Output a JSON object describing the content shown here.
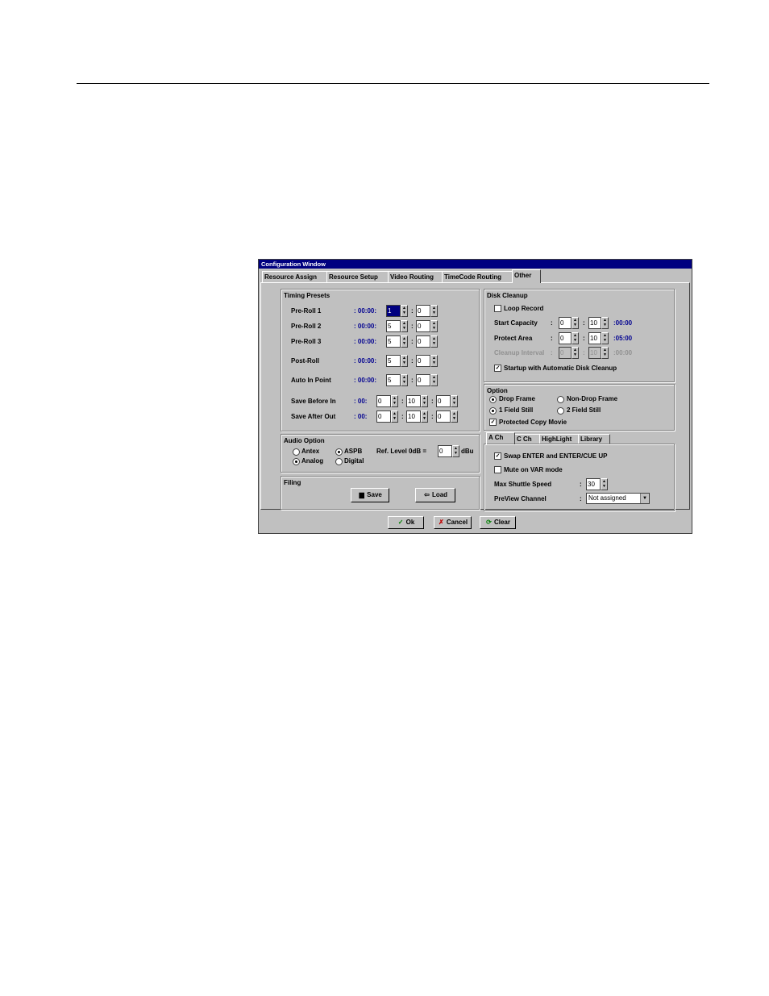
{
  "window": {
    "title": "Configuration Window"
  },
  "tabs": [
    "Resource Assign",
    "Resource Setup",
    "Video Routing",
    "TimeCode Routing",
    "Other"
  ],
  "timing_presets": {
    "title": "Timing Presets",
    "prefix": ": 00:00:",
    "short_prefix": ": 00:",
    "rows": [
      {
        "label": "Pre-Roll 1",
        "sec": "1",
        "frm": "0"
      },
      {
        "label": "Pre-Roll 2",
        "sec": "5",
        "frm": "0"
      },
      {
        "label": "Pre-Roll 3",
        "sec": "5",
        "frm": "0"
      },
      {
        "label": "Post-Roll",
        "sec": "5",
        "frm": "0"
      },
      {
        "label": "Auto In Point",
        "sec": "5",
        "frm": "0"
      }
    ],
    "save_rows": [
      {
        "label": "Save Before In",
        "min": "0",
        "sec": "10",
        "frm": "0"
      },
      {
        "label": "Save After Out",
        "min": "0",
        "sec": "10",
        "frm": "0"
      }
    ]
  },
  "audio_option": {
    "title": "Audio Option",
    "radio1": [
      "Antex",
      "Analog"
    ],
    "radio2": [
      "ASPB",
      "Digital"
    ],
    "ref_label": "Ref. Level 0dB =",
    "ref_value": "0",
    "ref_unit": "dBu"
  },
  "filing": {
    "title": "Filing",
    "save": "Save",
    "load": "Load"
  },
  "disk_cleanup": {
    "title": "Disk Cleanup",
    "loop_record": "Loop Record",
    "start_capacity": {
      "label": "Start Capacity",
      "a": "0",
      "b": "10",
      "suffix": ":00:00"
    },
    "protect_area": {
      "label": "Protect Area",
      "a": "0",
      "b": "10",
      "suffix": ":05:00"
    },
    "cleanup_interval": {
      "label": "Cleanup Interval",
      "a": "0",
      "b": "10",
      "suffix": ":00:00"
    },
    "startup": "Startup with Automatic Disk Cleanup"
  },
  "option": {
    "title": "Option",
    "drop_frame": "Drop Frame",
    "non_drop_frame": "Non-Drop Frame",
    "field1": "1 Field Still",
    "field2": "2 Field Still",
    "protected": "Protected Copy Movie"
  },
  "channel_tabs": [
    "A Ch",
    "C Ch",
    "HighLight",
    "Library"
  ],
  "channel": {
    "swap": "Swap ENTER and ENTER/CUE UP",
    "mute": "Mute on VAR mode",
    "shuttle_label": "Max Shuttle Speed",
    "shuttle_value": "30",
    "preview_label": "PreView Channel",
    "preview_value": "Not assigned",
    "colon": ":"
  },
  "buttons": {
    "ok": "Ok",
    "cancel": "Cancel",
    "clear": "Clear"
  },
  "icons": {
    "check": "check-icon",
    "x": "x-icon",
    "refresh": "refresh-icon",
    "disk": "floppy-disk-icon",
    "load": "load-icon"
  },
  "glyphs": {
    "check": "✓",
    "x": "✗",
    "refresh": "⟳",
    "disk": "▆",
    "load": "⇦",
    "tick": "✓",
    "up": "▲",
    "down": "▼"
  }
}
